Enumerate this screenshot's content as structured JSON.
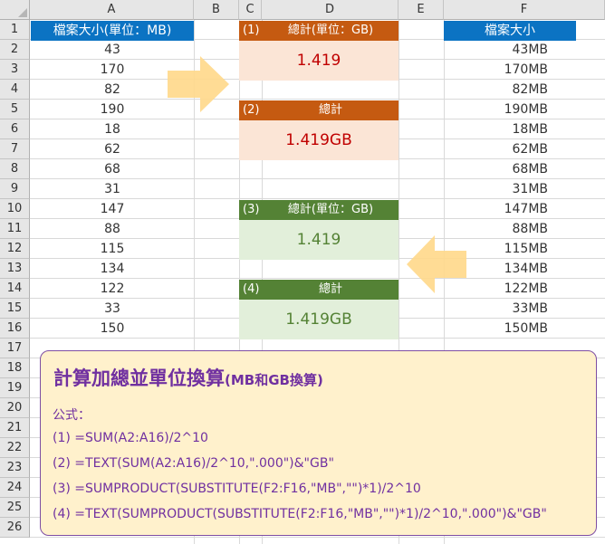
{
  "columns": [
    "A",
    "B",
    "C",
    "D",
    "E",
    "F"
  ],
  "rows": [
    "1",
    "2",
    "3",
    "4",
    "5",
    "6",
    "7",
    "8",
    "9",
    "10",
    "11",
    "12",
    "13",
    "14",
    "15",
    "16",
    "17",
    "18",
    "19",
    "20",
    "21",
    "22",
    "23",
    "24",
    "25",
    "26"
  ],
  "colA": {
    "header": "檔案大小(單位：MB)",
    "values": [
      "43",
      "170",
      "82",
      "190",
      "18",
      "62",
      "68",
      "31",
      "147",
      "88",
      "115",
      "134",
      "122",
      "33",
      "150"
    ]
  },
  "colF": {
    "header": "檔案大小",
    "values": [
      "43MB",
      "170MB",
      "82MB",
      "190MB",
      "18MB",
      "62MB",
      "68MB",
      "31MB",
      "147MB",
      "88MB",
      "115MB",
      "134MB",
      "122MB",
      "33MB",
      "150MB"
    ]
  },
  "sections": [
    {
      "tag": "(1)",
      "label": "總計(單位：GB)",
      "result": "1.419"
    },
    {
      "tag": "(2)",
      "label": "總計",
      "result": "1.419GB"
    },
    {
      "tag": "(3)",
      "label": "總計(單位：GB)",
      "result": "1.419"
    },
    {
      "tag": "(4)",
      "label": "總計",
      "result": "1.419GB"
    }
  ],
  "note": {
    "title_main": "計算加總並單位換算",
    "title_sub": "(MB和GB換算)",
    "formula_label": "公式：",
    "formulas": [
      "(1) =SUM(A2:A16)/2^10",
      "(2) =TEXT(SUM(A2:A16)/2^10,\".000\")&\"GB\"",
      "(3) =SUMPRODUCT(SUBSTITUTE(F2:F16,\"MB\",\"\")*1)/2^10",
      "(4) =TEXT(SUMPRODUCT(SUBSTITUTE(F2:F16,\"MB\",\"\")*1)/2^10,\".000\")&\"GB\""
    ]
  },
  "colors": {
    "blue_header": "#0b73c3",
    "orange_band": "#c55a11",
    "orange_fill": "#fbe5d6",
    "red_text": "#c00000",
    "green_band": "#548235",
    "green_fill": "#e2efda",
    "green_text": "#548235",
    "note_fill": "#fff1cc",
    "note_text": "#7030a0",
    "arrow": "#ffd88a"
  },
  "icons": [
    "right-arrow-icon",
    "left-arrow-icon",
    "select-all-icon"
  ]
}
